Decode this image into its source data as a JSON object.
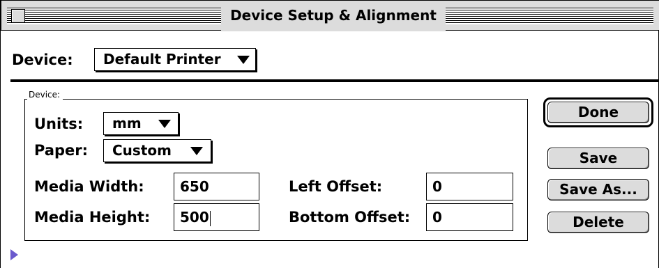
{
  "window": {
    "title": "Device Setup & Alignment"
  },
  "device_row": {
    "label": "Device:",
    "selected": "Default Printer"
  },
  "group": {
    "legend": "Device:",
    "units": {
      "label": "Units:",
      "selected": "mm"
    },
    "paper": {
      "label": "Paper:",
      "selected": "Custom"
    },
    "media_width": {
      "label": "Media Width:",
      "value": "650"
    },
    "media_height": {
      "label": "Media Height:",
      "value": "500"
    },
    "left_offset": {
      "label": "Left Offset:",
      "value": "0"
    },
    "bottom_offset": {
      "label": "Bottom Offset:",
      "value": "0"
    }
  },
  "buttons": {
    "done": "Done",
    "save": "Save",
    "save_as": "Save As...",
    "delete": "Delete"
  },
  "icons": {
    "close_box": "close-box-icon",
    "disclosure": "disclosure-triangle-icon",
    "popup_arrow": "chevron-down-icon"
  },
  "colors": {
    "disclosure": "#6a5acd",
    "button_face": "#dcdcdc"
  }
}
